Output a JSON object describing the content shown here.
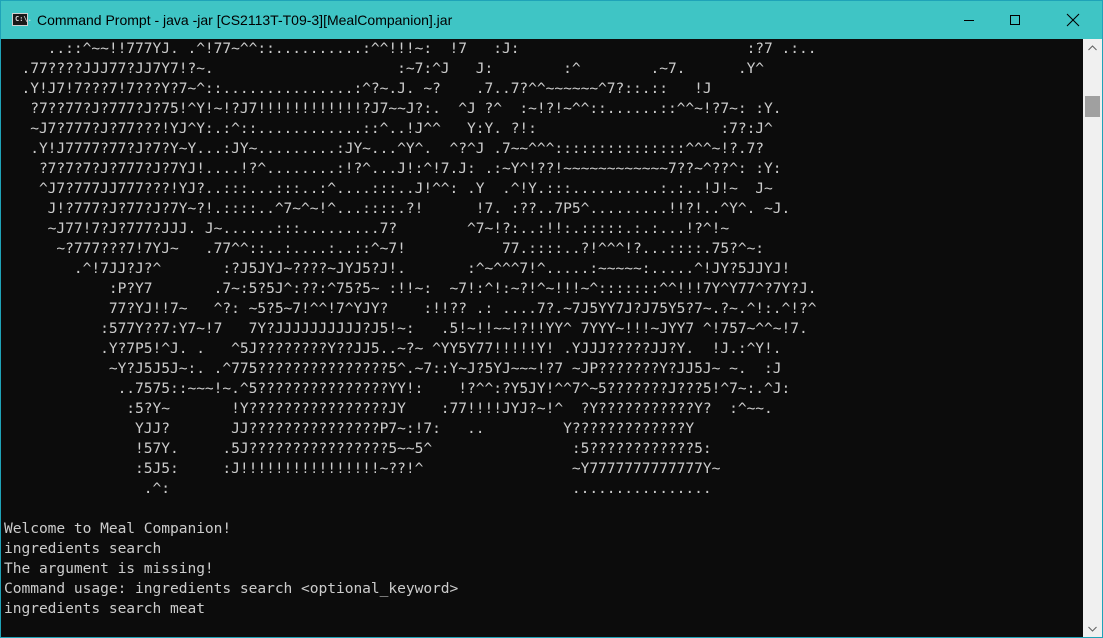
{
  "window": {
    "title": "Command Prompt - java  -jar [CS2113T-T09-3][MealCompanion].jar",
    "icon_label": "C:\\.",
    "titlebar_color": "#3fc5c5",
    "console_bg": "#0c0c0c",
    "console_fg": "#cccccc"
  },
  "controls": {
    "minimize": "minimize-icon",
    "maximize": "maximize-icon",
    "close": "close-icon"
  },
  "console": {
    "ascii_art": "     ..::^~~!!777YJ. .^!77~^^::..........:^^!!!~:  !7   :J:                          :?7 .:..\n  .77????JJJ77?JJ7Y7!?~.                     :~7:^J   J:        :^        .~7.      .Y^\n  .Y!J7!7???7!7???Y?7~^::...............:^?~.J. ~?    .7..7?^^~~~~~~^7?::.::   !J\n   ?7??77?J?777?J?75!^Y!~!?J7!!!!!!!!!!!!?J7~~J?:.  ^J ?^  :~!?!~^^::......::^^~!?7~: :Y.\n   ~J7?777?J?77???!YJ^Y:.:^::............::^..!J^^   Y:Y. ?!:                     :7?:J^\n   .Y!J7777?77?J?7?Y~Y...:JY~.........:JY~...^Y^.  ^?^J .7~~^^^:::::::::::::::^^^~!?.7?\n    ?7?7?7?J?777?J?7YJ!....!?^........:!?^...J!:^!7.J: .:~Y^!??!~~~~~~~~~~~~7??~^??^: :Y:\n    ^J7?777JJ777???!YJ?..:::...:::..:^....:::..J!^^: .Y  .^!Y.:::..........:.:..!J!~  J~\n     J!?777?J?77?J?7Y~?!.::::..^7~^~!^...::::.?!      !7. :??..7P5^.........!!?!..^Y^. ~J.\n     ~J77!7?J?777?JJJ. J~......:::.........7?        ^7~!?:..:!!:.:::::.:.:...!?^!~\n      ~?777???7!7YJ~   .77^^::..:....:..::^~7!           77.::::..?!^^^!?...::::.75?^~:\n        .^!7JJ?J?^       :?J5JYJ~????~JYJ5?J!.       :^~^^^7!^.....:~~~~~:.....^!JY?5JJYJ!\n            :P?Y7       .7~:5?5J^:??:^75?5~ :!!~:  ~7!:^!:~?!^~!!!~^:::::::^^!!!7Y^Y77^?7Y?J.\n            77?YJ!!7~   ^?: ~5?5~7!^^!7^YJY?    :!!?? .: ....7?.~7J5YY7J?J75Y5?7~.?~.^!:.^!?^\n           :577Y??7:Y7~!7   7Y?JJJJJJJJJJ?J5!~:   .5!~!!~~!?!!YY^ 7YYY~!!!~JYY7 ^!757~^^~!7.\n           .Y?7P5!^J. .   ^5J????????Y??JJ5..~?~ ^YY5Y77!!!!!Y! .YJJJ?????JJ?Y.  !J.:^Y!.\n            ~Y?J5J5J~:. .^775???????????????5^.~7::Y~J?5YJ~~~!?7 ~JP???????Y?JJ5J~ ~.  :J\n             ..7575::~~~!~.^5???????????????YY!:    !?^^:?Y5JY!^^7^~5???????J???5!^7~:.^J:\n              :5?Y~       !Y????????????????JY    :77!!!!JYJ?~!^  ?Y???????????Y?  :^~~.\n               YJJ?       JJ???????????????P7~:!7:   ..         Y?????????????Y\n               !57Y.     .5J????????????????5~~5^                :5????????????5:\n               :5J5:     :J!!!!!!!!!!!!!!!!~??!^                 ~Y7777777777777Y~\n                .^:                                              ................",
    "output_lines": [
      "Welcome to Meal Companion!",
      "ingredients search",
      "The argument is missing!",
      "Command usage: ingredients search <optional_keyword>",
      "ingredients search meat"
    ]
  },
  "scrollbar": {
    "up_icon": "chevron-up-icon",
    "down_icon": "chevron-down-icon"
  }
}
